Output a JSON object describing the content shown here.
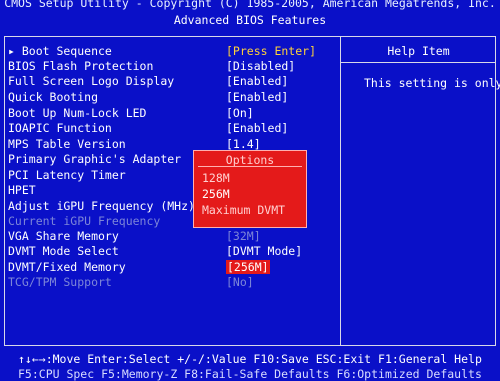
{
  "header": {
    "line1": "CMOS Setup Utility - Copyright (C) 1985-2005, American Megatrends, Inc.",
    "line2": "Advanced BIOS Features"
  },
  "menu": [
    {
      "label": "▸ Boot Sequence",
      "value": "[Press Enter]",
      "state": "selected"
    },
    {
      "label": "BIOS Flash Protection",
      "value": "[Disabled]",
      "state": "normal"
    },
    {
      "label": "Full Screen Logo Display",
      "value": "[Enabled]",
      "state": "normal"
    },
    {
      "label": "Quick Booting",
      "value": "[Enabled]",
      "state": "normal"
    },
    {
      "label": "Boot Up Num-Lock LED",
      "value": "[On]",
      "state": "normal"
    },
    {
      "label": "IOAPIC Function",
      "value": "[Enabled]",
      "state": "normal"
    },
    {
      "label": "MPS Table Version",
      "value": "[1.4]",
      "state": "normal"
    },
    {
      "label": "Primary Graphic's Adapter",
      "value": "",
      "state": "normal"
    },
    {
      "label": "PCI Latency Timer",
      "value": "",
      "state": "normal"
    },
    {
      "label": "HPET",
      "value": "",
      "state": "normal"
    },
    {
      "label": "Adjust iGPU Frequency (MHz)",
      "value": "",
      "state": "normal"
    },
    {
      "label": "Current iGPU Frequency",
      "value": "",
      "state": "dim"
    },
    {
      "label": "VGA Share Memory",
      "value": "[32M]",
      "state": "dim-value"
    },
    {
      "label": "DVMT Mode Select",
      "value": "[DVMT Mode]",
      "state": "normal"
    },
    {
      "label": "DVMT/Fixed Memory",
      "value": "[256M]",
      "state": "highlight"
    },
    {
      "label": "TCG/TPM Support",
      "value": "[No]",
      "state": "dim"
    }
  ],
  "help": {
    "title": "Help Item",
    "text": "This setting is only"
  },
  "popup": {
    "title": "Options",
    "items": [
      {
        "label": "128M",
        "current": false
      },
      {
        "label": "256M",
        "current": true
      },
      {
        "label": "Maximum DVMT",
        "current": false
      }
    ]
  },
  "footer": {
    "line1": "↑↓←→:Move  Enter:Select  +/-/:Value  F10:Save  ESC:Exit  F1:General Help",
    "line2": "F5:CPU Spec    F5:Memory-Z    F8:Fail-Safe Defaults    F6:Optimized Defaults"
  },
  "colors": {
    "background": "#0a10c8",
    "selected_value": "#ffd23a",
    "highlight": "#e41a1a",
    "dim_text": "#7d86d8"
  }
}
